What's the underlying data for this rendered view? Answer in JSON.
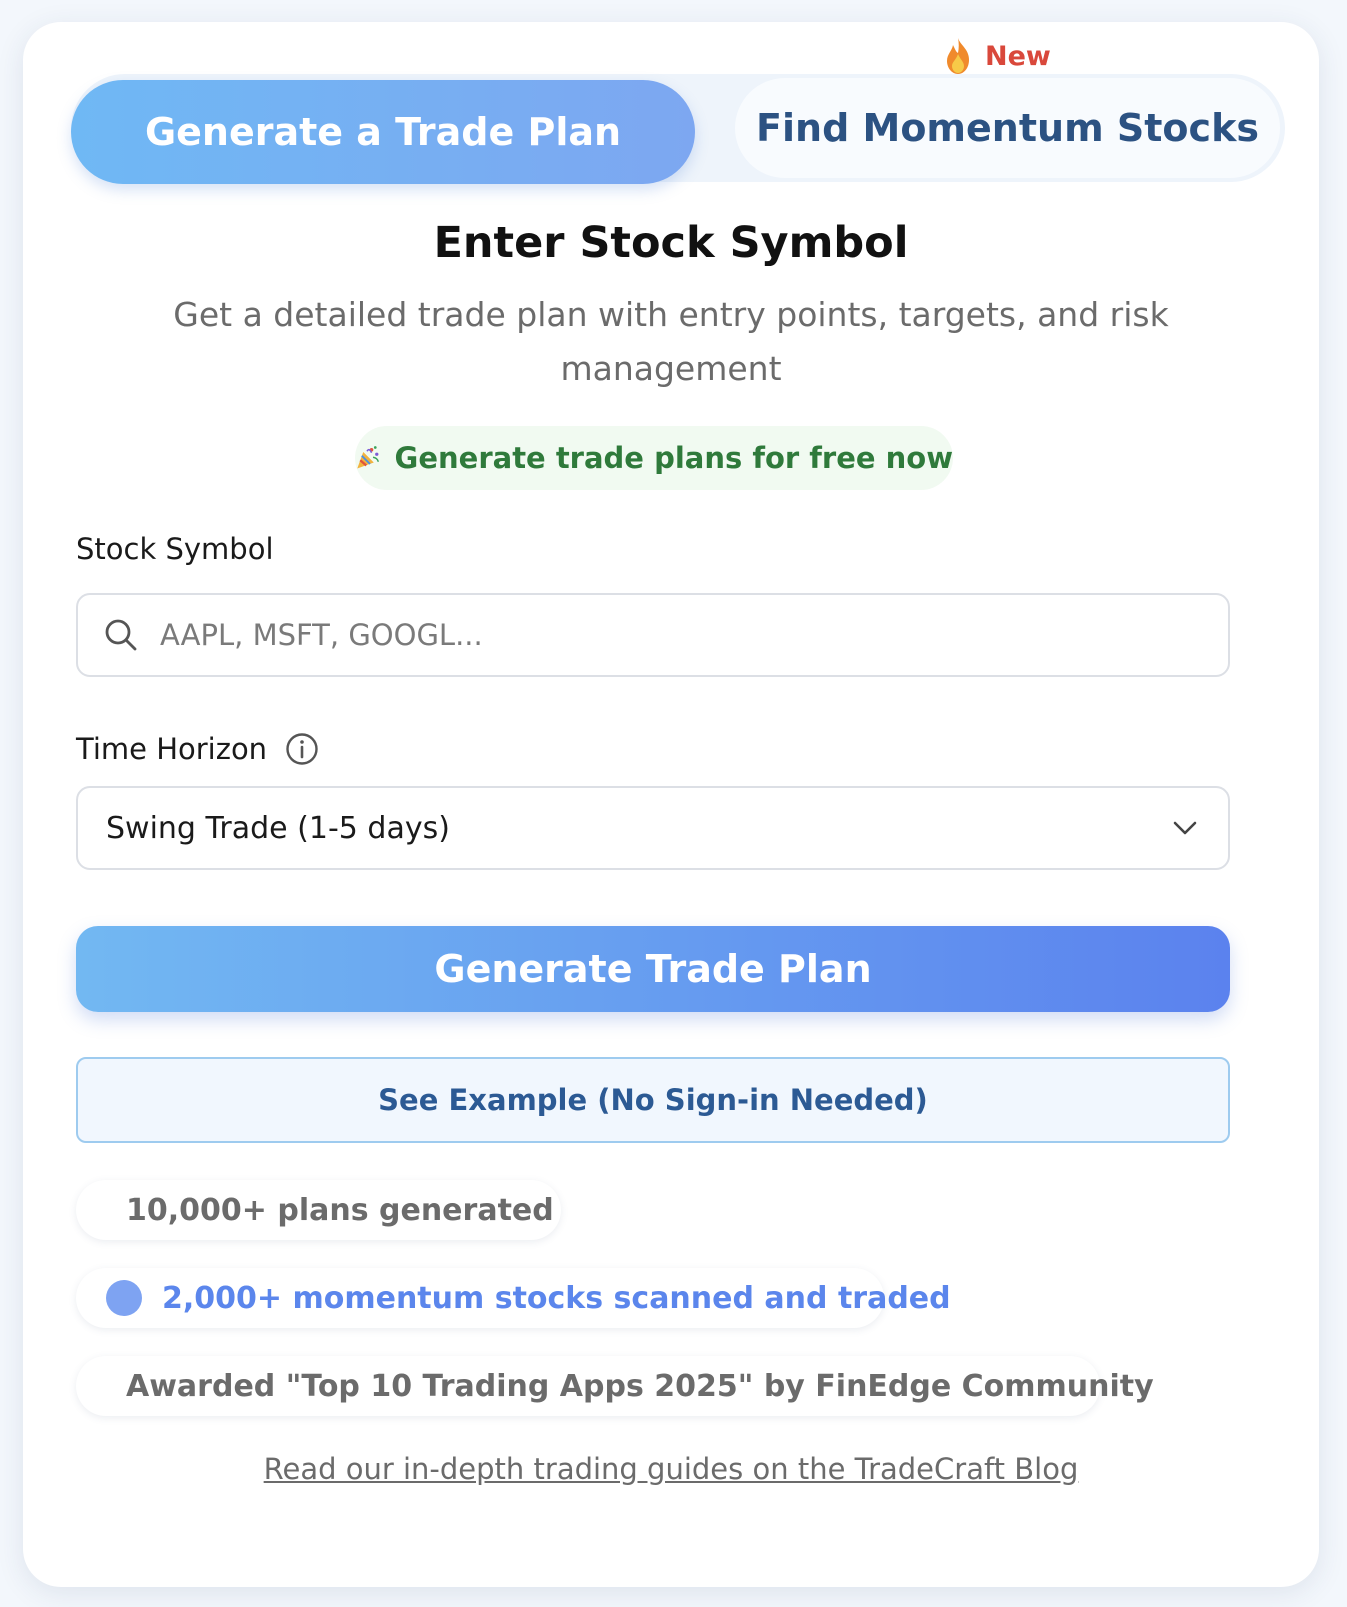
{
  "badge": {
    "label": "New",
    "icon": "fire-icon"
  },
  "tabs": [
    {
      "label": "Generate a Trade Plan",
      "active": true
    },
    {
      "label": "Find Momentum Stocks",
      "active": false
    }
  ],
  "header": {
    "title": "Enter Stock Symbol",
    "subtitle": "Get a detailed trade plan with entry points, targets, and risk management"
  },
  "promo": {
    "icon": "party-popper-icon",
    "text": "Generate trade plans for free now"
  },
  "form": {
    "symbol_label": "Stock Symbol",
    "symbol_placeholder": "AAPL, MSFT, GOOGL...",
    "symbol_value": "",
    "horizon_label": "Time Horizon",
    "horizon_selected": "Swing Trade (1-5 days)"
  },
  "actions": {
    "primary": "Generate Trade Plan",
    "example": "See Example (No Sign-in Needed)"
  },
  "stats": [
    {
      "icon": "checkmark-icon",
      "text": "10,000+ plans generated"
    },
    {
      "icon": "blue-dot-icon",
      "text": "2,000+ momentum stocks scanned and traded"
    },
    {
      "icon": "star-icon",
      "text": "Awarded \"Top 10 Trading Apps 2025\" by FinEdge Community"
    }
  ],
  "footer": {
    "link_text": "Read our in-depth trading guides on the TradeCraft Blog"
  },
  "colors": {
    "accent_start": "#72b8f2",
    "accent_end": "#5b82ee",
    "tab_inactive_text": "#2c5282",
    "new_badge": "#d9483b",
    "promo_text": "#2f7a3b",
    "momentum_text": "#5b86ec"
  }
}
